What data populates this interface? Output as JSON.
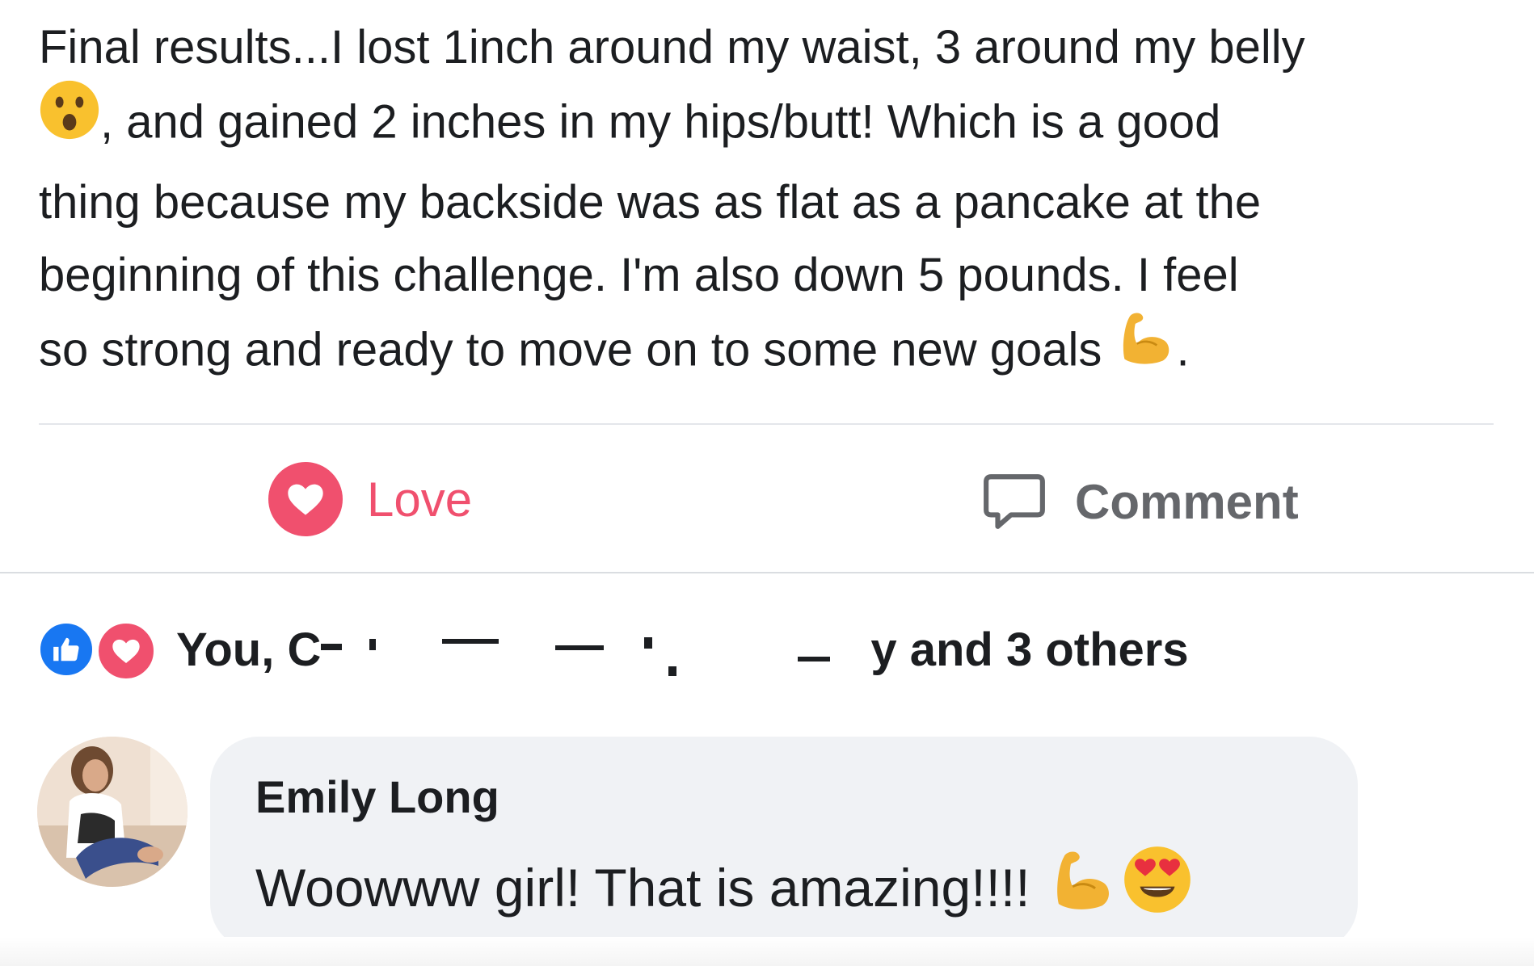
{
  "post": {
    "lines": [
      "Final results...I lost 1inch around my waist, 3 around my belly",
      ", and gained 2 inches in my hips/butt! Which is a good",
      "thing because my backside was as flat as a pancake at the",
      "beginning of this challenge. I'm also down 5 pounds. I feel",
      "so strong and ready to move on to some new goals",
      "."
    ],
    "emojis": [
      "astonished-face-emoji",
      "flexed-biceps-emoji"
    ]
  },
  "actions": {
    "love_label": "Love",
    "comment_label": "Comment"
  },
  "reactions": {
    "prefix": "You, C",
    "suffix": "y and 3 others",
    "icons": [
      "like-icon",
      "love-icon"
    ]
  },
  "comment": {
    "author": "Emily Long",
    "text": "Woowww girl! That is amazing!!!!",
    "emojis": [
      "flexed-biceps-emoji",
      "heart-eyes-emoji"
    ]
  },
  "colors": {
    "love": "#f0506e",
    "like": "#1877f2",
    "muted": "#65676b",
    "bubble": "#f0f2f5"
  }
}
